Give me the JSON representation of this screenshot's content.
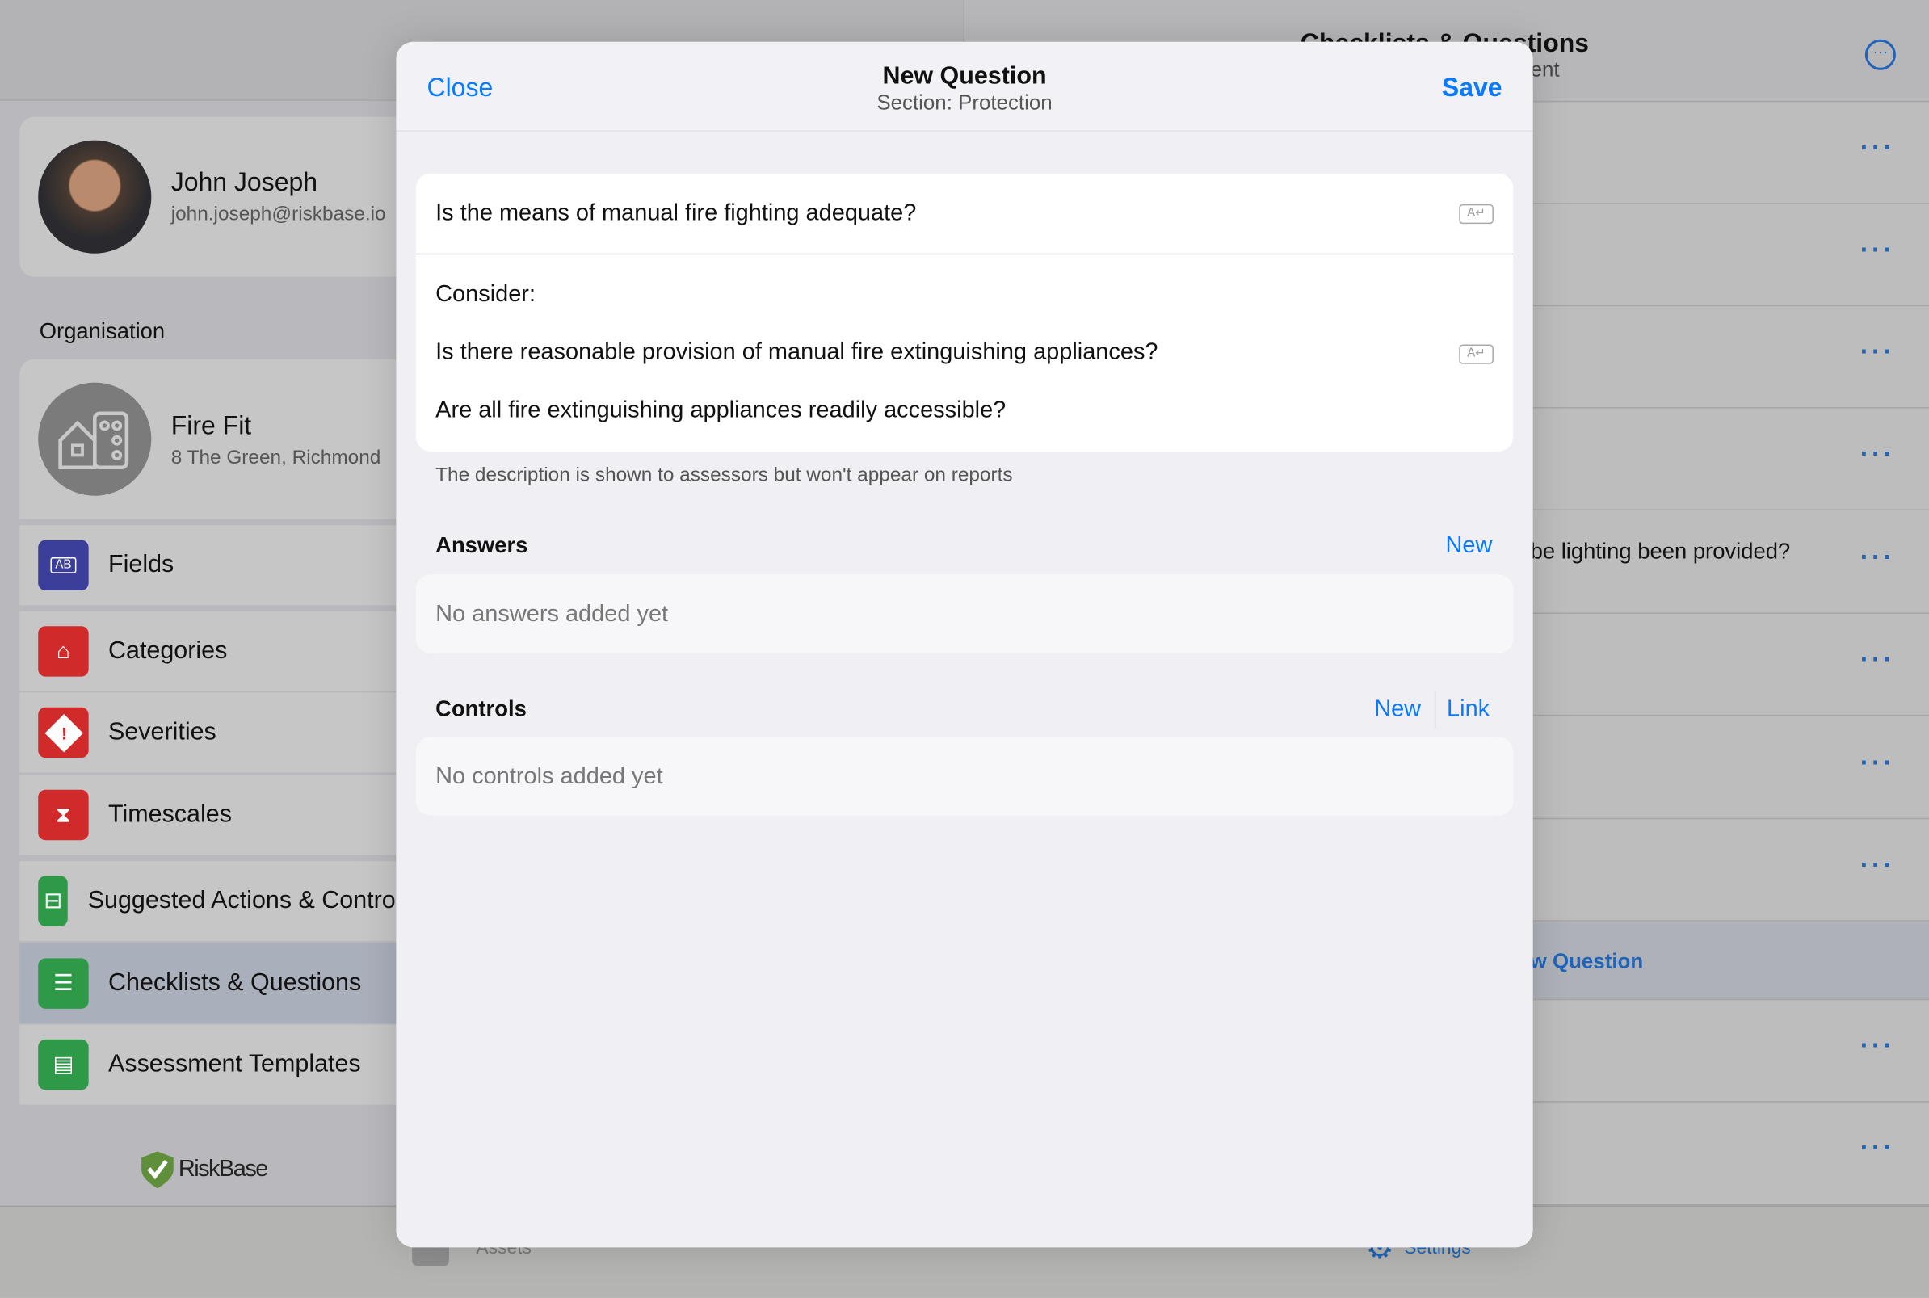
{
  "sidebar": {
    "user": {
      "name": "John Joseph",
      "email": "john.joseph@riskbase.io"
    },
    "section_label": "Organisation",
    "org": {
      "name": "Fire Fit",
      "address": "8 The Green, Richmond"
    },
    "items": [
      {
        "label": "Fields",
        "icon": "fields-ab-icon",
        "color": "#3b3f9a"
      },
      {
        "label": "Categories",
        "icon": "tag-icon",
        "color": "#d12a2a"
      },
      {
        "label": "Severities",
        "icon": "warning-diamond-icon",
        "color": "#d12a2a"
      },
      {
        "label": "Timescales",
        "icon": "hourglass-icon",
        "color": "#d12a2a"
      },
      {
        "label": "Suggested Actions & Controls",
        "icon": "signpost-icon",
        "color": "#2e9a47"
      },
      {
        "label": "Checklists & Questions",
        "icon": "checklist-icon",
        "color": "#2e9a47",
        "selected": true
      },
      {
        "label": "Assessment Templates",
        "icon": "template-icon",
        "color": "#2e9a47"
      }
    ],
    "logo": "RiskBase"
  },
  "right_pane": {
    "title": "Checklists & Questions",
    "subtitle": "ent",
    "visible_row_text": "be lighting been provided?",
    "new_question_link": "w Question"
  },
  "tabbar": {
    "assets": "Assets",
    "settings": "Settings"
  },
  "modal": {
    "close": "Close",
    "title": "New Question",
    "subtitle": "Section: Protection",
    "save": "Save",
    "question": "Is the means of manual fire fighting adequate?",
    "description_lines": [
      "Consider:",
      "Is there reasonable provision of manual fire extinguishing appliances?",
      "Are all fire extinguishing appliances readily accessible?"
    ],
    "description_note": "The description is shown to assessors but won't appear on reports",
    "answers": {
      "label": "Answers",
      "new": "New",
      "empty": "No answers added yet"
    },
    "controls": {
      "label": "Controls",
      "new": "New",
      "link": "Link",
      "empty": "No controls added yet"
    }
  },
  "colors": {
    "accent": "#0a7aff",
    "overlay_accent": "#1f64b8",
    "selected_row": "#a9afbb"
  }
}
